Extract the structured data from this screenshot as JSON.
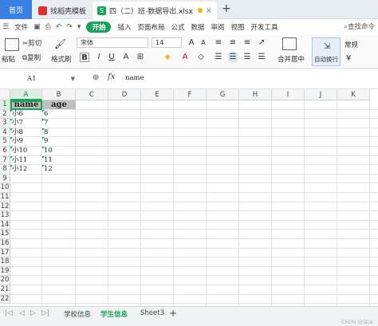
{
  "tabs": {
    "home": "首页",
    "doc1": "找稻壳模板",
    "doc2": "四（二）班-数据导出.xlsx",
    "doc2_icon": "S"
  },
  "menu": {
    "file": "文件",
    "start": "开始",
    "insert": "插入",
    "layout": "页面布局",
    "formula": "公式",
    "data": "数据",
    "review": "审阅",
    "view": "视图",
    "dev": "开发工具",
    "search": "查找命令"
  },
  "ribbon": {
    "cut": "剪切",
    "paste": "粘贴",
    "copy": "复制",
    "format_painter": "格式刷",
    "font": "宋体",
    "font_size": "14",
    "merge": "合并居中",
    "wrap": "自动换行",
    "normal": "常规"
  },
  "formula_bar": {
    "cell_ref": "A1",
    "content": "name"
  },
  "columns": [
    "A",
    "B",
    "C",
    "D",
    "E",
    "F",
    "G",
    "H",
    "I",
    "J",
    "K"
  ],
  "rows": [
    "1",
    "2",
    "3",
    "4",
    "5",
    "6",
    "7",
    "8",
    "9",
    "10",
    "11",
    "12",
    "13",
    "14",
    "15",
    "16",
    "17",
    "18",
    "19",
    "20",
    "21",
    "22"
  ],
  "cells": {
    "A1": "name",
    "B1": "age",
    "A2": "小6",
    "B2": "6",
    "A3": "小7",
    "B3": "7",
    "A4": "小8",
    "B4": "8",
    "A5": "小9",
    "B5": "9",
    "A6": "小10",
    "B6": "10",
    "A7": "小11",
    "B7": "11",
    "A8": "小12",
    "B8": "12"
  },
  "sheets": [
    "学校信息",
    "学生信息",
    "Sheet3"
  ],
  "active_sheet": "学生信息",
  "watermark": "CSDN @深冰",
  "colors": {
    "accent": "#1aa35b",
    "home_tab": "#3a7fe4"
  }
}
